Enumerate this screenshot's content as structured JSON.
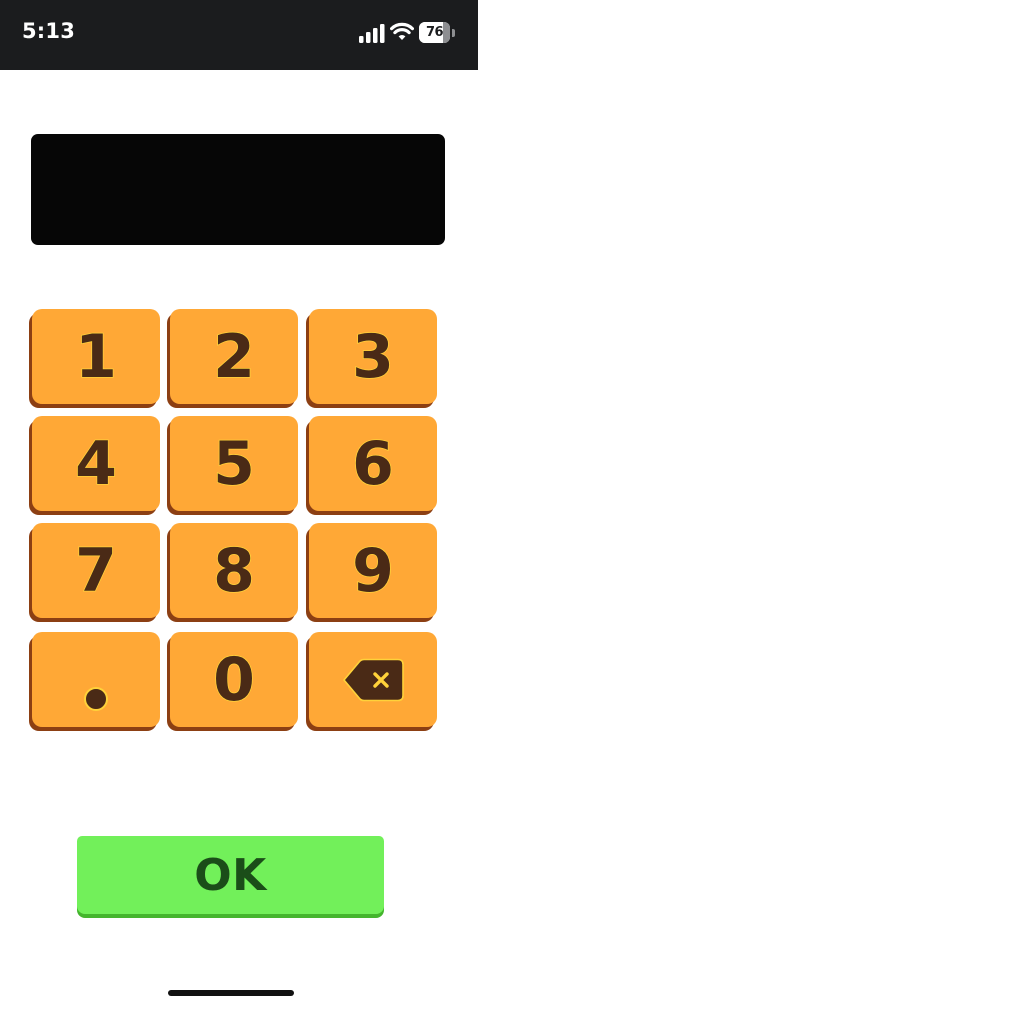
{
  "status_bar": {
    "time": "5:13",
    "signal_icon": "cellular-signal-icon",
    "wifi_icon": "wifi-icon",
    "battery_icon": "battery-icon",
    "battery_percent": "76",
    "battery_level": 0.76
  },
  "display": {
    "value": ""
  },
  "keypad": {
    "keys": [
      {
        "label": "1"
      },
      {
        "label": "2"
      },
      {
        "label": "3"
      },
      {
        "label": "4"
      },
      {
        "label": "5"
      },
      {
        "label": "6"
      },
      {
        "label": "7"
      },
      {
        "label": "8"
      },
      {
        "label": "9"
      },
      {
        "label": "."
      },
      {
        "label": "0"
      },
      {
        "icon": "backspace-icon"
      }
    ]
  },
  "ok_button": {
    "label": "OK"
  },
  "colors": {
    "status_bar_bg": "#1b1c1e",
    "display_bg": "#060606",
    "key_bg": "#ffa836",
    "key_shadow": "#8c3f13",
    "key_text": "#4a2a16",
    "key_text_outline": "#ffd23a",
    "ok_bg": "#72f05a",
    "ok_shadow": "#44b52d",
    "ok_text": "#1b4d19"
  }
}
